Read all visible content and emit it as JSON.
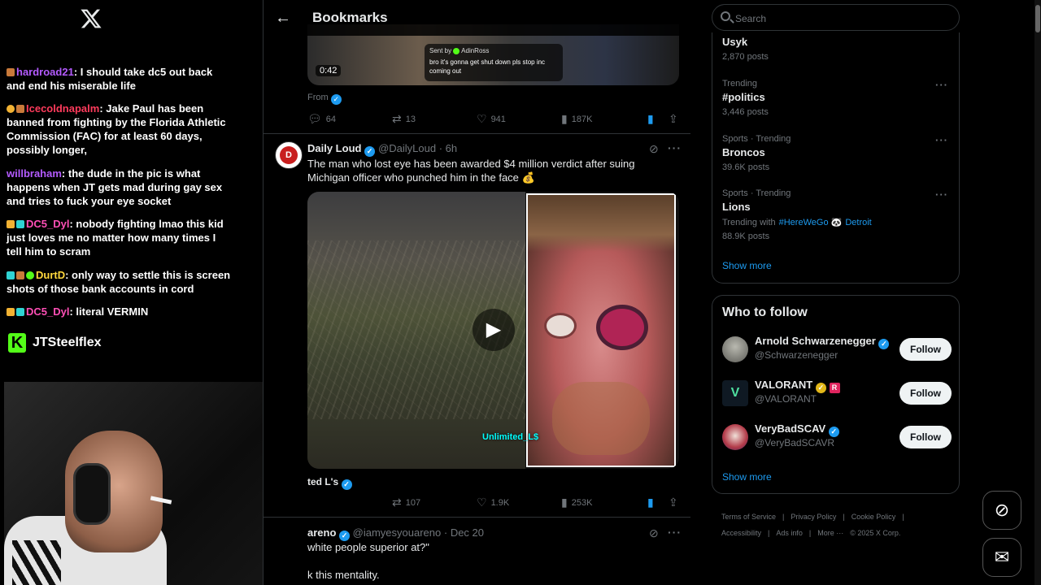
{
  "stream": {
    "chat": [
      {
        "user": "hardroad21",
        "text": ": I should take dc5 out back and end his miserable life"
      },
      {
        "user": "Icecoldnapalm",
        "text": ": Jake Paul has been banned from fighting by the Florida Athletic Commission (FAC) for at least 60 days, possibly longer,"
      },
      {
        "user": "willbraham",
        "text": ": the dude in the pic is what happens when JT gets mad during gay sex and tries to fuck your eye socket"
      },
      {
        "user": "DC5_Dyl",
        "text": ": nobody fighting lmao this kid just loves me no matter how many times I tell him to scram"
      },
      {
        "user": "DurtD",
        "text": ": only way to settle this is screen shots of those bank accounts in cord"
      },
      {
        "user": "DC5_Dyl",
        "text": ": literal VERMIN"
      }
    ],
    "streamer_name": "JTSteelflex",
    "colors": {
      "kick": "#53fc18"
    }
  },
  "header": {
    "title": "Bookmarks"
  },
  "tweets": [
    {
      "video_duration": "0:42",
      "dm_sender": "Sent by",
      "dm_name": "AdinRoss",
      "dm_text": "bro it's gonna get shut down pls stop inc coming out",
      "from_label": "From",
      "replies": "64",
      "reposts": "13",
      "likes": "941",
      "views": "187K"
    },
    {
      "name": "Daily Loud",
      "handle": "@DailyLoud",
      "time": "· 6h",
      "avatar_text": "D",
      "text": "The man who lost eye has been awarded $4 million verdict after suing Michigan officer who punched him in the face 💰",
      "watermark": "Unlimited_L$",
      "quote_name": "ted L's",
      "reposts": "107",
      "likes": "1.9K",
      "views": "253K"
    },
    {
      "name": "areno",
      "handle": "@iamyesyouareno",
      "time": "· Dec 20",
      "text1": "white people superior at?\"",
      "text2": "k this mentality."
    }
  ],
  "search": {
    "placeholder": "Search"
  },
  "trends": [
    {
      "meta": "",
      "name": "Usyk",
      "count": "2,870 posts"
    },
    {
      "meta": "Trending",
      "name": "#politics",
      "count": "3,446 posts"
    },
    {
      "meta": "Sports · Trending",
      "name": "Broncos",
      "count": "39.6K posts"
    },
    {
      "meta": "Sports · Trending",
      "name": "Lions",
      "with_label": "Trending with",
      "with_tags": [
        "#HereWeGo",
        "Detroit"
      ],
      "count": "88.9K posts"
    }
  ],
  "trends_show_more": "Show more",
  "who_to_follow": {
    "title": "Who to follow",
    "accounts": [
      {
        "name": "Arnold Schwarzenegger",
        "handle": "@Schwarzenegger",
        "button": "Follow"
      },
      {
        "name": "VALORANT",
        "handle": "@VALORANT",
        "button": "Follow"
      },
      {
        "name": "VeryBadSCAV",
        "handle": "@VeryBadSCAVR",
        "button": "Follow"
      }
    ],
    "show_more": "Show more"
  },
  "footer": {
    "links": [
      "Terms of Service",
      "|",
      "Privacy Policy",
      "|",
      "Cookie Policy",
      "|"
    ],
    "links2": [
      "Accessibility",
      "|",
      "Ads info",
      "|",
      "More ···",
      "© 2025 X Corp."
    ]
  },
  "colors": {
    "accent": "#1d9bf0",
    "background": "#000000",
    "border": "#2f3336"
  }
}
